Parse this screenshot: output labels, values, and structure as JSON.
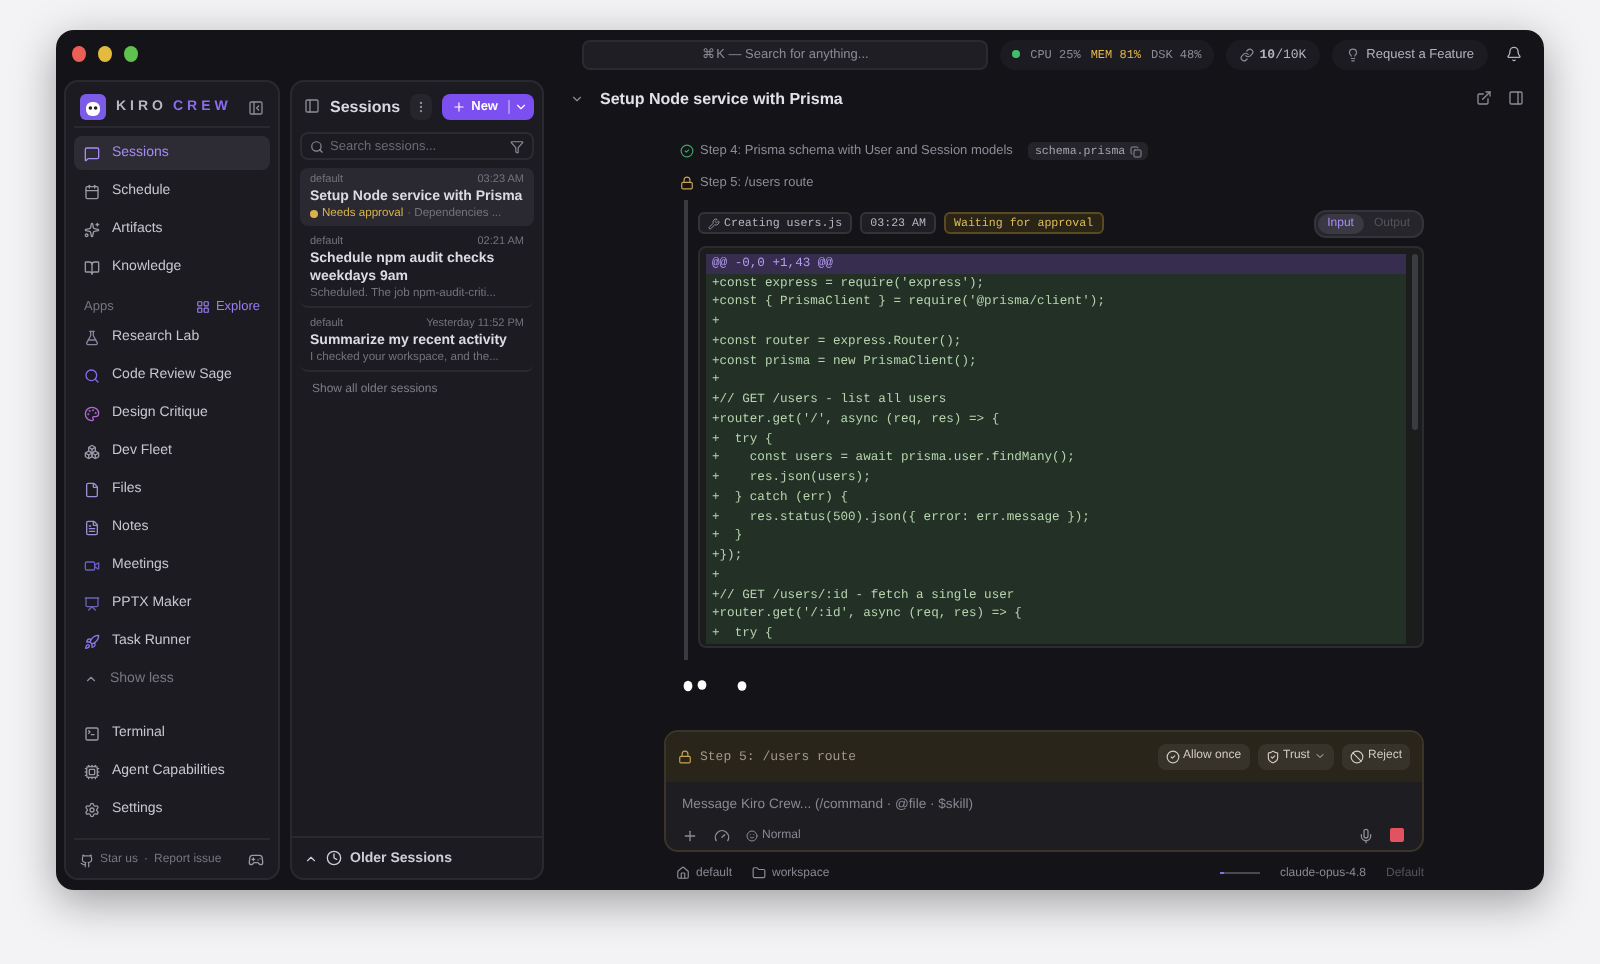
{
  "topbar": {
    "search_placeholder": "⌘K — Search for anything...",
    "stats": [
      {
        "text": "CPU 25%",
        "warning": false
      },
      {
        "text": "MEM 81%",
        "warning": true
      },
      {
        "text": "DSK 48%",
        "warning": false
      }
    ],
    "tokens": "**10**/10K",
    "request_button": "Request a Feature"
  },
  "sidebar": {
    "brand": [
      "KIRO",
      "CREW"
    ],
    "nav": [
      {
        "label": "Sessions",
        "selected": true
      },
      {
        "label": "Schedule",
        "selected": false
      },
      {
        "label": "Artifacts",
        "selected": false
      },
      {
        "label": "Knowledge",
        "selected": false
      }
    ],
    "apps_heading": "Apps",
    "explore": "Explore",
    "apps": [
      "Research Lab",
      "Code Review Sage",
      "Design Critique",
      "Dev Fleet",
      "Files",
      "Notes",
      "Meetings",
      "PPTX Maker",
      "Task Runner"
    ],
    "show_less": "Show less",
    "bottom": [
      "Terminal",
      "Agent Capabilities",
      "Settings"
    ],
    "footer_links": [
      "Star us",
      "Report issue"
    ],
    "footer_separator": "·"
  },
  "sessions": {
    "title": "Sessions",
    "new_button": "New",
    "search_placeholder": "Search sessions...",
    "items": [
      {
        "workspace": "default",
        "time": "03:23 AM",
        "title": "Setup Node service with Prisma",
        "status": "Needs approval",
        "preview": "· Dependencies ...",
        "selected": true
      },
      {
        "workspace": "default",
        "time": "02:21 AM",
        "title": "Schedule npm audit checks weekdays 9am",
        "preview": "Scheduled. The job npm-audit-criti...",
        "selected": false
      },
      {
        "workspace": "default",
        "time": "Yesterday 11:52 PM",
        "title": "Summarize my recent activity",
        "preview": "I checked your workspace, and the...",
        "selected": false
      }
    ],
    "show_all": "Show all older sessions",
    "older": "Older Sessions"
  },
  "main": {
    "title": "Setup Node service with Prisma",
    "steps": [
      {
        "kind": "done",
        "text": "Step 4: Prisma schema with User and Session models",
        "file": "schema.prisma"
      },
      {
        "kind": "pending",
        "text": "Step 5: /users route"
      }
    ],
    "tool": {
      "action": "Creating users.js",
      "time": "03:23 AM",
      "status": "Waiting for approval",
      "tabs": [
        {
          "label": "Input",
          "selected": true
        },
        {
          "label": "Output",
          "selected": false
        }
      ],
      "lines": [
        {
          "kind": "hunk",
          "text": "@@ -0,0 +1,43 @@"
        },
        {
          "kind": "add",
          "text": "+const express = require('express');"
        },
        {
          "kind": "add",
          "text": "+const { PrismaClient } = require('@prisma/client');"
        },
        {
          "kind": "add",
          "text": "+"
        },
        {
          "kind": "add",
          "text": "+const router = express.Router();"
        },
        {
          "kind": "add",
          "text": "+const prisma = new PrismaClient();"
        },
        {
          "kind": "add",
          "text": "+"
        },
        {
          "kind": "add",
          "text": "+// GET /users - list all users"
        },
        {
          "kind": "add",
          "text": "+router.get('/', async (req, res) => {"
        },
        {
          "kind": "add",
          "text": "+  try {"
        },
        {
          "kind": "add",
          "text": "+    const users = await prisma.user.findMany();"
        },
        {
          "kind": "add",
          "text": "+    res.json(users);"
        },
        {
          "kind": "add",
          "text": "+  } catch (err) {"
        },
        {
          "kind": "add",
          "text": "+    res.status(500).json({ error: err.message });"
        },
        {
          "kind": "add",
          "text": "+  }"
        },
        {
          "kind": "add",
          "text": "+});"
        },
        {
          "kind": "add",
          "text": "+"
        },
        {
          "kind": "add",
          "text": "+// GET /users/:id - fetch a single user"
        },
        {
          "kind": "add",
          "text": "+router.get('/:id', async (req, res) => {"
        },
        {
          "kind": "add",
          "text": "+  try {"
        }
      ]
    }
  },
  "composer": {
    "approval": "Step 5: /users route",
    "actions": [
      "Allow once",
      "Trust",
      "Reject"
    ],
    "placeholder": "Message Kiro Crew... (/command · @file · $skill)",
    "mode": "Normal"
  },
  "status_bar": {
    "profile": "default",
    "folder": "workspace",
    "context": {
      "level": 0.1
    },
    "model": "claude-opus-4.8",
    "model_mode": "Default"
  }
}
